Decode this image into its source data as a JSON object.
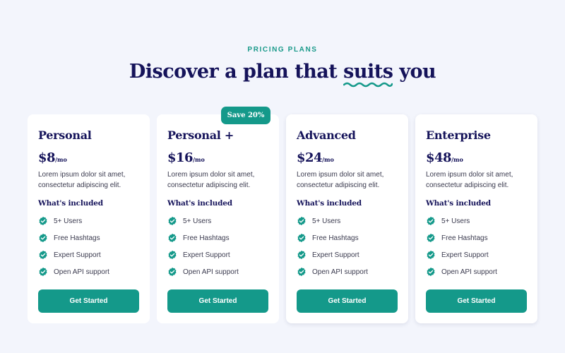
{
  "header": {
    "eyebrow": "PRICING PLANS",
    "headline_before": "Discover a plan that ",
    "headline_highlight": "suits",
    "headline_after": " you"
  },
  "badge": {
    "label": "Save 20%"
  },
  "colors": {
    "accent": "#14998a",
    "heading": "#15135a",
    "background": "#f3f5fc",
    "card": "#ffffff",
    "body_text": "#3b3b4f"
  },
  "plans": [
    {
      "name": "Personal",
      "price": "$8",
      "period": "/mo",
      "description": "Lorem ipsum dolor sit amet, consectetur adipiscing elit.",
      "included_label": "What's included",
      "features": [
        "5+ Users",
        "Free Hashtags",
        "Expert Support",
        "Open API support"
      ],
      "cta": "Get Started"
    },
    {
      "name": "Personal +",
      "price": "$16",
      "period": "/mo",
      "description": "Lorem ipsum dolor sit amet, consectetur adipiscing elit.",
      "included_label": "What's included",
      "features": [
        "5+ Users",
        "Free Hashtags",
        "Expert Support",
        "Open API support"
      ],
      "cta": "Get Started"
    },
    {
      "name": "Advanced",
      "price": "$24",
      "period": "/mo",
      "description": "Lorem ipsum dolor sit amet, consectetur adipiscing elit.",
      "included_label": "What's included",
      "features": [
        "5+ Users",
        "Free Hashtags",
        "Expert Support",
        "Open API support"
      ],
      "cta": "Get Started"
    },
    {
      "name": "Enterprise",
      "price": "$48",
      "period": "/mo",
      "description": "Lorem ipsum dolor sit amet, consectetur adipiscing elit.",
      "included_label": "What's included",
      "features": [
        "5+ Users",
        "Free Hashtags",
        "Expert Support",
        "Open API support"
      ],
      "cta": "Get Started"
    }
  ],
  "icons": {
    "feature_check": "check-badge-icon",
    "headline_underline": "squiggle-underline-icon"
  }
}
